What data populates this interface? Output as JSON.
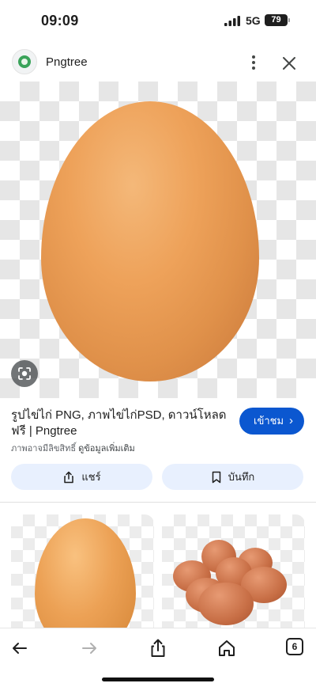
{
  "status": {
    "time": "09:09",
    "network": "5G",
    "battery": "79"
  },
  "header": {
    "site_name": "Pngtree"
  },
  "result": {
    "title": "รูปไข่ไก่ PNG, ภาพไข่ไก่PSD, ดาวน์โหลดฟรี | Pngtree",
    "copyright_note": "ภาพอาจมีลิขสิทธิ์",
    "more_info_link": "ดูข้อมูลเพิ่มเติม",
    "visit_label": "เข้าชม",
    "share_label": "แชร์",
    "save_label": "บันทึก"
  },
  "browser": {
    "tab_count": "6"
  },
  "icons": [
    "logo-icon",
    "more-vert-icon",
    "close-icon",
    "lens-icon",
    "share-icon",
    "bookmark-icon",
    "back-arrow-icon",
    "forward-arrow-icon",
    "share-sheet-icon",
    "home-icon",
    "tabs-icon"
  ],
  "colors": {
    "accent": "#0b57d0",
    "tonal_button": "#e8f0fe",
    "text": "#1f1f1f"
  }
}
